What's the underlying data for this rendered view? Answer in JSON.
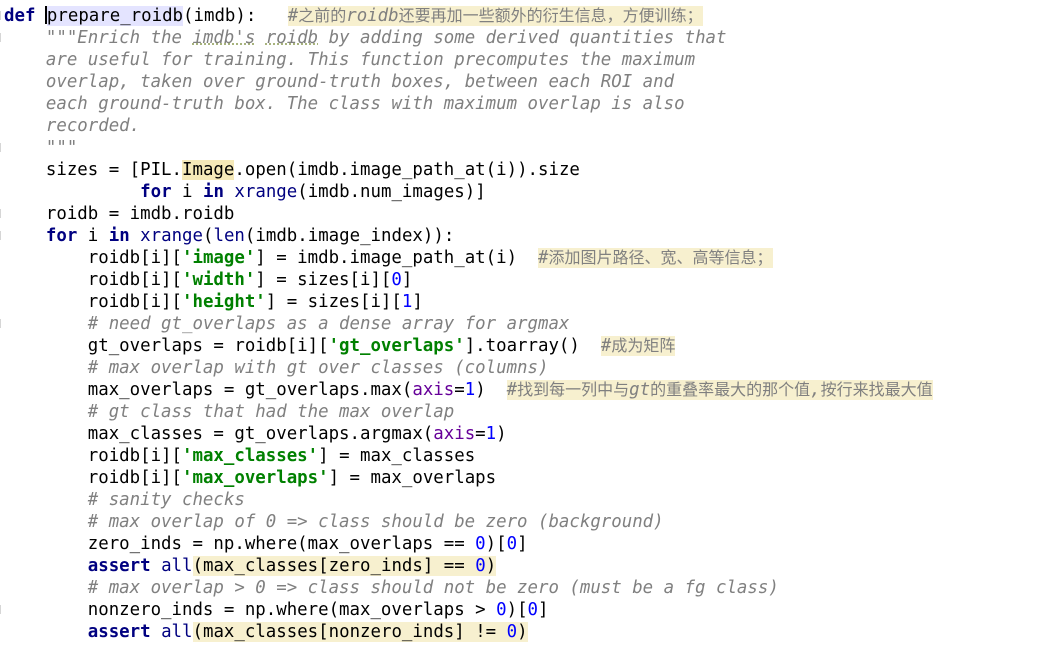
{
  "editor": {
    "language": "python",
    "colors": {
      "keyword": "#000080",
      "string": "#008000",
      "number": "#0000ff",
      "kwarg": "#660099",
      "comment": "#808080",
      "highlight": "#f7f0cf",
      "function_highlight": "#e4e4ff"
    },
    "lines": [
      {
        "indent": 0,
        "tokens": [
          {
            "t": "def",
            "c": "kw"
          },
          {
            "t": " "
          },
          {
            "t": "",
            "c": "caret"
          },
          {
            "t": "prepare_roidb",
            "c": "fn-hl"
          },
          {
            "t": "(imdb):   "
          },
          {
            "t": "#之前的roidb还要再加一些额外的衍生信息，方便训练；",
            "c": "cmt hl"
          }
        ]
      },
      {
        "indent": 4,
        "tokens": [
          {
            "t": "\"\"\"Enrich the ",
            "c": "doc"
          },
          {
            "t": "imdb's",
            "c": "doc spell"
          },
          {
            "t": " ",
            "c": "doc"
          },
          {
            "t": "roidb",
            "c": "doc spell"
          },
          {
            "t": " by adding some derived quantities that",
            "c": "doc"
          }
        ]
      },
      {
        "indent": 4,
        "tokens": [
          {
            "t": "are useful for training. This function precomputes the maximum",
            "c": "doc"
          }
        ]
      },
      {
        "indent": 4,
        "tokens": [
          {
            "t": "overlap, taken over ground-truth boxes, between each ROI and",
            "c": "doc"
          }
        ]
      },
      {
        "indent": 4,
        "tokens": [
          {
            "t": "each ground-truth box. The class with maximum overlap is also",
            "c": "doc"
          }
        ]
      },
      {
        "indent": 4,
        "tokens": [
          {
            "t": "recorded.",
            "c": "doc"
          }
        ]
      },
      {
        "indent": 4,
        "tokens": [
          {
            "t": "\"\"\"",
            "c": "doc"
          }
        ]
      },
      {
        "indent": 4,
        "tokens": [
          {
            "t": "sizes = [PIL."
          },
          {
            "t": "Image",
            "c": "hlm"
          },
          {
            "t": ".open(imdb.image_path_at(i)).size"
          }
        ]
      },
      {
        "indent": 13,
        "tokens": [
          {
            "t": "for",
            "c": "kw"
          },
          {
            "t": " i "
          },
          {
            "t": "in",
            "c": "kw"
          },
          {
            "t": " "
          },
          {
            "t": "xrange",
            "c": "bi"
          },
          {
            "t": "(imdb.num_images)]"
          }
        ]
      },
      {
        "indent": 4,
        "tokens": [
          {
            "t": "roidb = imdb.roidb"
          }
        ]
      },
      {
        "indent": 4,
        "tokens": [
          {
            "t": "for",
            "c": "kw"
          },
          {
            "t": " i "
          },
          {
            "t": "in",
            "c": "kw"
          },
          {
            "t": " "
          },
          {
            "t": "xrange",
            "c": "bi"
          },
          {
            "t": "("
          },
          {
            "t": "len",
            "c": "bi"
          },
          {
            "t": "(imdb.image_index)):"
          }
        ]
      },
      {
        "indent": 8,
        "tokens": [
          {
            "t": "roidb[i]["
          },
          {
            "t": "'image'",
            "c": "str"
          },
          {
            "t": "] = imdb.image_path_at(i)  "
          },
          {
            "t": "#添加图片路径、宽、高等信息；",
            "c": "cmt hl"
          }
        ]
      },
      {
        "indent": 8,
        "tokens": [
          {
            "t": "roidb[i]["
          },
          {
            "t": "'width'",
            "c": "str"
          },
          {
            "t": "] = sizes[i]["
          },
          {
            "t": "0",
            "c": "num"
          },
          {
            "t": "]"
          }
        ]
      },
      {
        "indent": 8,
        "tokens": [
          {
            "t": "roidb[i]["
          },
          {
            "t": "'height'",
            "c": "str"
          },
          {
            "t": "] = sizes[i]["
          },
          {
            "t": "1",
            "c": "num"
          },
          {
            "t": "]"
          }
        ]
      },
      {
        "indent": 8,
        "tokens": [
          {
            "t": "# need gt_overlaps as a dense array for argmax",
            "c": "cmt"
          }
        ]
      },
      {
        "indent": 8,
        "tokens": [
          {
            "t": "gt_overlaps = roidb[i]["
          },
          {
            "t": "'gt_overlaps'",
            "c": "str"
          },
          {
            "t": "].toarray()  "
          },
          {
            "t": "#成为矩阵",
            "c": "cmt hl"
          }
        ]
      },
      {
        "indent": 8,
        "tokens": [
          {
            "t": "# max overlap with gt over classes (columns)",
            "c": "cmt"
          }
        ]
      },
      {
        "indent": 8,
        "tokens": [
          {
            "t": "max_overlaps = gt_overlaps.max("
          },
          {
            "t": "axis",
            "c": "kwarg"
          },
          {
            "t": "="
          },
          {
            "t": "1",
            "c": "num"
          },
          {
            "t": ")  "
          },
          {
            "t": "#找到每一列中与gt的重叠率最大的那个值,按行来找最大值",
            "c": "cmt hl"
          }
        ]
      },
      {
        "indent": 8,
        "tokens": [
          {
            "t": "# gt class that had the max overlap",
            "c": "cmt"
          }
        ]
      },
      {
        "indent": 8,
        "tokens": [
          {
            "t": "max_classes = gt_overlaps.argmax("
          },
          {
            "t": "axis",
            "c": "kwarg"
          },
          {
            "t": "="
          },
          {
            "t": "1",
            "c": "num"
          },
          {
            "t": ")"
          }
        ]
      },
      {
        "indent": 8,
        "tokens": [
          {
            "t": "roidb[i]["
          },
          {
            "t": "'max_classes'",
            "c": "str"
          },
          {
            "t": "] = max_classes"
          }
        ]
      },
      {
        "indent": 8,
        "tokens": [
          {
            "t": "roidb[i]["
          },
          {
            "t": "'max_overlaps'",
            "c": "str"
          },
          {
            "t": "] = max_overlaps"
          }
        ]
      },
      {
        "indent": 8,
        "tokens": [
          {
            "t": "# sanity checks",
            "c": "cmt"
          }
        ]
      },
      {
        "indent": 8,
        "tokens": [
          {
            "t": "# max overlap of 0 => class should be zero (background)",
            "c": "cmt"
          }
        ]
      },
      {
        "indent": 8,
        "tokens": [
          {
            "t": "zero_inds = np.where(max_overlaps == "
          },
          {
            "t": "0",
            "c": "num"
          },
          {
            "t": ")["
          },
          {
            "t": "0",
            "c": "num"
          },
          {
            "t": "]"
          }
        ]
      },
      {
        "indent": 8,
        "tokens": [
          {
            "t": "assert",
            "c": "kw"
          },
          {
            "t": " "
          },
          {
            "t": "all",
            "c": "bi"
          },
          {
            "t": "(",
            "c": "hl"
          },
          {
            "t": "max_classes[zero_inds] == ",
            "c": "hl"
          },
          {
            "t": "0",
            "c": "num hl"
          },
          {
            "t": ")",
            "c": "hl"
          }
        ]
      },
      {
        "indent": 8,
        "tokens": [
          {
            "t": "# max overlap > 0 => class should not be zero (must be a fg class)",
            "c": "cmt"
          }
        ]
      },
      {
        "indent": 8,
        "tokens": [
          {
            "t": "nonzero_inds = np.where(max_overlaps > "
          },
          {
            "t": "0",
            "c": "num"
          },
          {
            "t": ")["
          },
          {
            "t": "0",
            "c": "num"
          },
          {
            "t": "]"
          }
        ]
      },
      {
        "indent": 8,
        "tokens": [
          {
            "t": "assert",
            "c": "kw"
          },
          {
            "t": " "
          },
          {
            "t": "all",
            "c": "bi"
          },
          {
            "t": "(",
            "c": "hl"
          },
          {
            "t": "max_classes[nonzero_inds] != ",
            "c": "hl"
          },
          {
            "t": "0",
            "c": "num hl"
          },
          {
            "t": ")",
            "c": "hl"
          }
        ]
      }
    ]
  }
}
